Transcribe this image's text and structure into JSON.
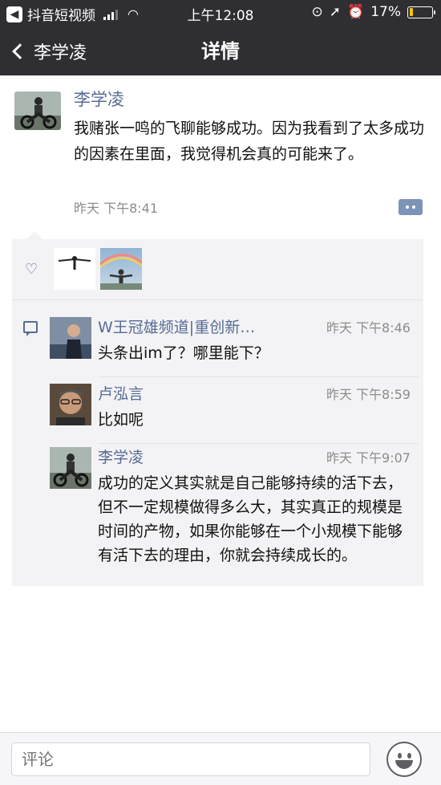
{
  "status_bar": {
    "back_app_label": "抖音短视频",
    "time": "上午12:08",
    "battery_percent_text": "17%",
    "battery_level": 0.17
  },
  "nav": {
    "back_label": "李学凌",
    "title": "详情"
  },
  "post": {
    "author": "李学凌",
    "text": "我赌张一鸣的飞聊能够成功。因为我看到了太多成功的因素在里面，我觉得机会真的可能来了。",
    "time": "昨天 下午8:41"
  },
  "likes": {
    "count_shown": 2
  },
  "comments": [
    {
      "name": "W王冠雄频道|重创新…",
      "time": "昨天 下午8:46",
      "text": "头条出im了？哪里能下？"
    },
    {
      "name": "卢泓言",
      "time": "昨天 下午8:59",
      "text": "比如呢"
    },
    {
      "name": "李学凌",
      "time": "昨天 下午9:07",
      "text": "成功的定义其实就是自己能够持续的活下去，但不一定规模做得多么大，其实真正的规模是时间的产物，如果你能够在一个小规模下能够有活下去的理由，你就会持续成长的。"
    }
  ],
  "comment_box": {
    "placeholder": "评论"
  },
  "colors": {
    "nav_bg": "#2f2f33",
    "link_blue": "#576b95",
    "panel_bg": "#f3f3f5",
    "battery_fill": "#f5c400"
  },
  "icons": [
    "back-app-icon",
    "signal-icon",
    "wifi-icon",
    "lock-rotation-icon",
    "location-icon",
    "alarm-icon",
    "battery-icon",
    "chevron-left-icon",
    "more-dots-icon",
    "heart-icon",
    "comment-icon",
    "apple-icon",
    "emoji-icon"
  ]
}
